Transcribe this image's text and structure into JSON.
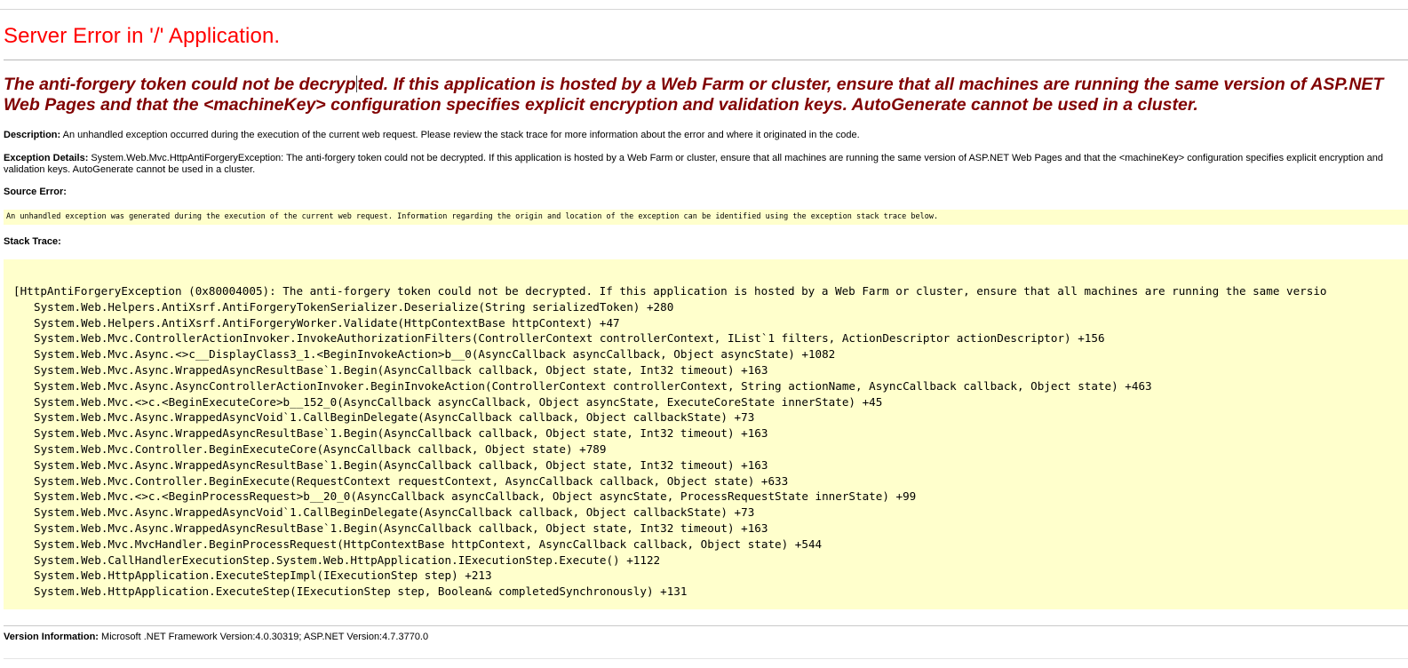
{
  "page": {
    "title": "Server Error in '/' Application.",
    "message_part1": "The anti-forgery token could not be decryp",
    "message_part2": "ted. If this application is hosted by a Web Farm or cluster, ensure that all machines are running the same version of ASP.NET Web Pages and that the <machineKey> configuration specifies explicit encryption and validation keys. AutoGenerate cannot be used in a cluster."
  },
  "description": {
    "label": "Description:",
    "text": " An unhandled exception occurred during the execution of the current web request. Please review the stack trace for more information about the error and where it originated in the code."
  },
  "exception_details": {
    "label": "Exception Details:",
    "text": " System.Web.Mvc.HttpAntiForgeryException: The anti-forgery token could not be decrypted. If this application is hosted by a Web Farm or cluster, ensure that all machines are running the same version of ASP.NET Web Pages and that the <machineKey> configuration specifies explicit encryption and validation keys. AutoGenerate cannot be used in a cluster."
  },
  "source_error": {
    "label": "Source Error:",
    "text": "An unhandled exception was generated during the execution of the current web request. Information regarding the origin and location of the exception can be identified using the exception stack trace below."
  },
  "stack_trace": {
    "label": "Stack Trace:",
    "header": "[HttpAntiForgeryException (0x80004005): The anti-forgery token could not be decrypted. If this application is hosted by a Web Farm or cluster, ensure that all machines are running the same versio",
    "frames": [
      "System.Web.Helpers.AntiXsrf.AntiForgeryTokenSerializer.Deserialize(String serializedToken) +280",
      "System.Web.Helpers.AntiXsrf.AntiForgeryWorker.Validate(HttpContextBase httpContext) +47",
      "System.Web.Mvc.ControllerActionInvoker.InvokeAuthorizationFilters(ControllerContext controllerContext, IList`1 filters, ActionDescriptor actionDescriptor) +156",
      "System.Web.Mvc.Async.<>c__DisplayClass3_1.<BeginInvokeAction>b__0(AsyncCallback asyncCallback, Object asyncState) +1082",
      "System.Web.Mvc.Async.WrappedAsyncResultBase`1.Begin(AsyncCallback callback, Object state, Int32 timeout) +163",
      "System.Web.Mvc.Async.AsyncControllerActionInvoker.BeginInvokeAction(ControllerContext controllerContext, String actionName, AsyncCallback callback, Object state) +463",
      "System.Web.Mvc.<>c.<BeginExecuteCore>b__152_0(AsyncCallback asyncCallback, Object asyncState, ExecuteCoreState innerState) +45",
      "System.Web.Mvc.Async.WrappedAsyncVoid`1.CallBeginDelegate(AsyncCallback callback, Object callbackState) +73",
      "System.Web.Mvc.Async.WrappedAsyncResultBase`1.Begin(AsyncCallback callback, Object state, Int32 timeout) +163",
      "System.Web.Mvc.Controller.BeginExecuteCore(AsyncCallback callback, Object state) +789",
      "System.Web.Mvc.Async.WrappedAsyncResultBase`1.Begin(AsyncCallback callback, Object state, Int32 timeout) +163",
      "System.Web.Mvc.Controller.BeginExecute(RequestContext requestContext, AsyncCallback callback, Object state) +633",
      "System.Web.Mvc.<>c.<BeginProcessRequest>b__20_0(AsyncCallback asyncCallback, Object asyncState, ProcessRequestState innerState) +99",
      "System.Web.Mvc.Async.WrappedAsyncVoid`1.CallBeginDelegate(AsyncCallback callback, Object callbackState) +73",
      "System.Web.Mvc.Async.WrappedAsyncResultBase`1.Begin(AsyncCallback callback, Object state, Int32 timeout) +163",
      "System.Web.Mvc.MvcHandler.BeginProcessRequest(HttpContextBase httpContext, AsyncCallback callback, Object state) +544",
      "System.Web.CallHandlerExecutionStep.System.Web.HttpApplication.IExecutionStep.Execute() +1122",
      "System.Web.HttpApplication.ExecuteStepImpl(IExecutionStep step) +213",
      "System.Web.HttpApplication.ExecuteStep(IExecutionStep step, Boolean& completedSynchronously) +131"
    ]
  },
  "version_info": {
    "label": "Version Information:",
    "text": " Microsoft .NET Framework Version:4.0.30319; ASP.NET Version:4.7.3770.0"
  },
  "colors": {
    "title": "#ff0000",
    "message": "#800000",
    "code_background": "#ffffcc"
  }
}
